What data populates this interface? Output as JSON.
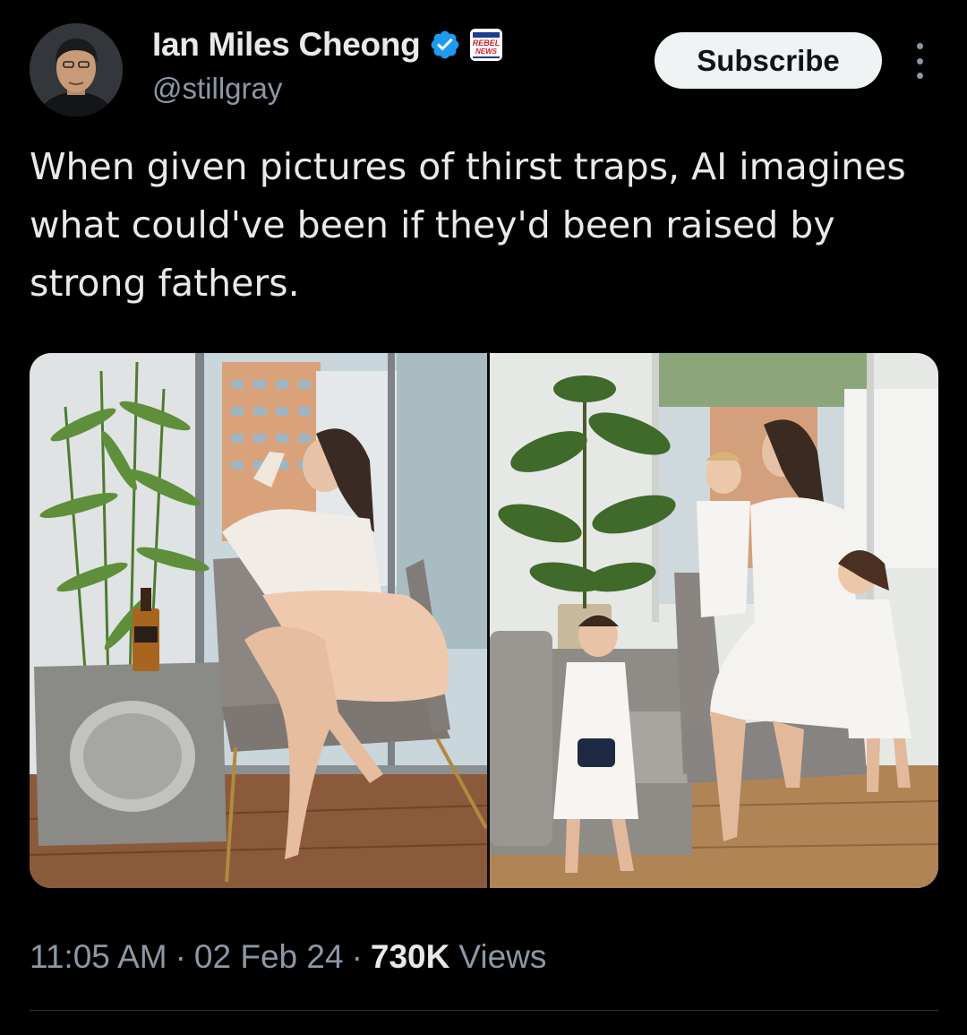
{
  "author": {
    "name": "Ian Miles Cheong",
    "handle": "@stillgray",
    "affiliate_badge_text": [
      "REBEL",
      "NEWS"
    ]
  },
  "actions": {
    "subscribe_label": "Subscribe"
  },
  "tweet": {
    "text": "When given pictures of thirst traps, AI imagines what could've been if they'd been raised by strong fathers."
  },
  "meta": {
    "time": "11:05 AM",
    "separator": "·",
    "date": "02 Feb 24",
    "views_count": "730K",
    "views_label": "Views"
  },
  "icons": {
    "verified": "verified-badge-icon",
    "more": "more-icon"
  },
  "colors": {
    "background": "#000000",
    "text": "#e7e9ea",
    "secondary_text": "#8b98a5",
    "verified_blue": "#1d9bf0",
    "button_bg": "#eff3f4",
    "affiliate_red": "#d3202a"
  }
}
